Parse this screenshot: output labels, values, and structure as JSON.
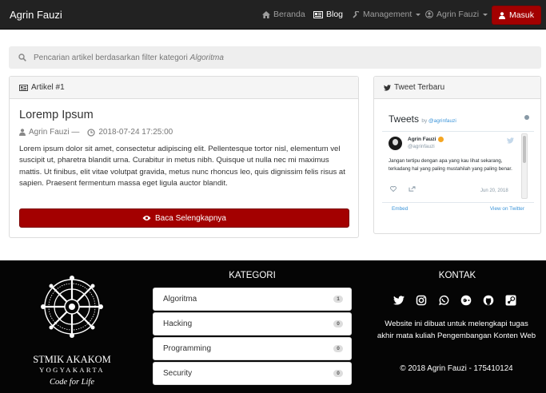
{
  "navbar": {
    "brand": "Agrin Fauzi",
    "beranda": "Beranda",
    "blog": "Blog",
    "management": "Management",
    "user": "Agrin Fauzi",
    "login": "Masuk",
    "icons": [
      "home-icon",
      "newspaper-icon",
      "wrench-icon",
      "user-circle-icon",
      "user-icon"
    ]
  },
  "search": {
    "text": "Pencarian artikel berdasarkan filter kategori",
    "category": "Algoritma"
  },
  "article_panel": {
    "heading": "Artikel #1",
    "title": "Loremp Ipsum",
    "author": "Agrin Fauzi —",
    "date": "2018-07-24 17:25:00",
    "body": "Lorem ipsum dolor sit amet, consectetur adipiscing elit. Pellentesque tortor nisl, elementum vel suscipit ut, pharetra blandit urna. Curabitur in metus nibh. Quisque ut nulla nec mi maximus mattis. Ut finibus, elit vitae volutpat gravida, metus nunc rhoncus leo, quis dignissim felis risus at sapien. Praesent fermentum massa eget ligula auctor blandit.",
    "read_more": "Baca Selengkapnya"
  },
  "tweet_panel": {
    "heading": "Tweet Terbaru",
    "widget_title": "Tweets",
    "by": "by",
    "by_handle": "@agrinfauzi",
    "tweet": {
      "name": "Agrin Fauzi",
      "handle": "@agrinfauzi",
      "text": "Jangan tertipu dengan apa yang kau lihat sekarang, terkadang hal yang paling mustahilah yang paling benar.",
      "date": "Jun 20, 2018"
    },
    "embed": "Embed",
    "view_on": "View on Twitter"
  },
  "footer": {
    "logo": {
      "name": "STMIK AKAKOM",
      "city": "YOGYAKARTA",
      "tagline": "Code for Life"
    },
    "kategori_title": "KATEGORI",
    "categories": [
      {
        "name": "Algoritma",
        "count": "1"
      },
      {
        "name": "Hacking",
        "count": "0"
      },
      {
        "name": "Programming",
        "count": "0"
      },
      {
        "name": "Security",
        "count": "0"
      }
    ],
    "kontak_title": "KONTAK",
    "social_icons": [
      "twitter-icon",
      "instagram-icon",
      "whatsapp-icon",
      "google-plus-icon",
      "github-icon",
      "steam-icon"
    ],
    "kontak_text": "Website ini dibuat untuk melengkapi tugas akhir mata kuliah Pengembangan Konten Web",
    "copyright": "© 2018 Agrin Fauzi - 175410124"
  },
  "colors": {
    "navbar": "#222222",
    "accent_red": "#a30000",
    "footer": "#050505",
    "twitter_blue": "#3b94d9"
  }
}
